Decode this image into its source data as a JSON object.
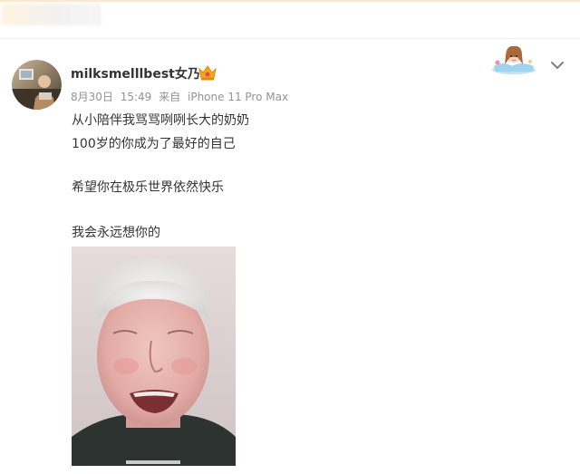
{
  "header": {
    "blurred_text": ""
  },
  "post": {
    "username": "milksmelllbest女乃",
    "vip_badge_icon": "vip-crown-icon",
    "meta": {
      "date": "8月30日",
      "time": "15:49",
      "source_prefix": "来自",
      "device": "iPhone 11 Pro Max"
    },
    "lines": [
      "从小陪伴我骂骂咧咧长大的奶奶",
      "100岁的你成为了最好的自己",
      "希望你在极乐世界依然快乐",
      "我会永远想你的"
    ],
    "menu_icon": "chevron-down-icon",
    "decoration": "anime-girl-sticker"
  },
  "colors": {
    "text": "#333333",
    "meta": "#939393",
    "badge": "#f5a623"
  }
}
